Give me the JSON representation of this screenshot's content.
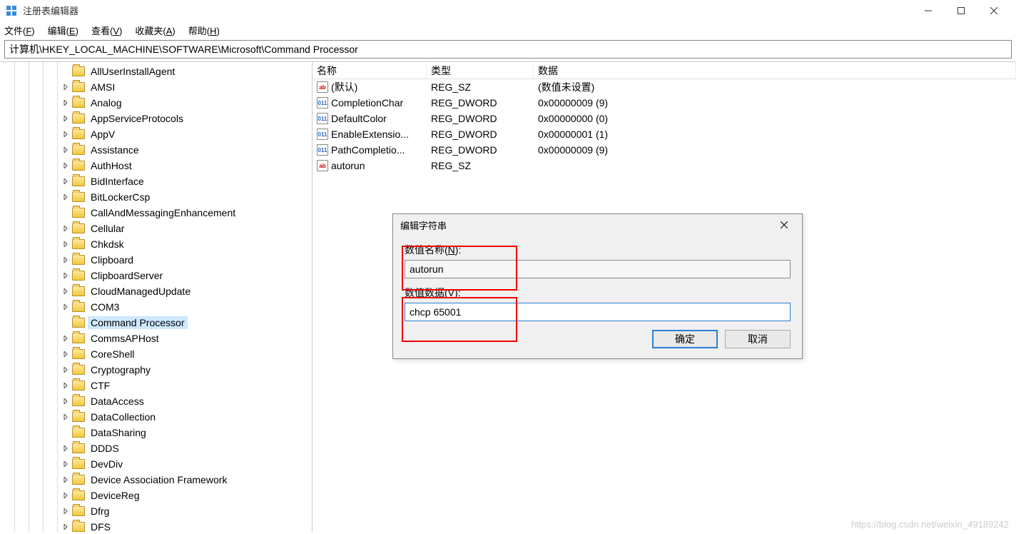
{
  "window": {
    "title": "注册表编辑器"
  },
  "menu": {
    "file": "文件(F)",
    "edit": "编辑(E)",
    "view": "查看(V)",
    "favorites": "收藏夹(A)",
    "help": "帮助(H)"
  },
  "address": "计算机\\HKEY_LOCAL_MACHINE\\SOFTWARE\\Microsoft\\Command Processor",
  "tree": {
    "items": [
      {
        "label": "AllUserInstallAgent",
        "expander": "none"
      },
      {
        "label": "AMSI",
        "expander": "closed"
      },
      {
        "label": "Analog",
        "expander": "closed"
      },
      {
        "label": "AppServiceProtocols",
        "expander": "closed"
      },
      {
        "label": "AppV",
        "expander": "closed"
      },
      {
        "label": "Assistance",
        "expander": "closed"
      },
      {
        "label": "AuthHost",
        "expander": "closed"
      },
      {
        "label": "BidInterface",
        "expander": "closed"
      },
      {
        "label": "BitLockerCsp",
        "expander": "closed"
      },
      {
        "label": "CallAndMessagingEnhancement",
        "expander": "none"
      },
      {
        "label": "Cellular",
        "expander": "closed"
      },
      {
        "label": "Chkdsk",
        "expander": "closed"
      },
      {
        "label": "Clipboard",
        "expander": "closed"
      },
      {
        "label": "ClipboardServer",
        "expander": "closed"
      },
      {
        "label": "CloudManagedUpdate",
        "expander": "closed"
      },
      {
        "label": "COM3",
        "expander": "closed"
      },
      {
        "label": "Command Processor",
        "expander": "none",
        "selected": true
      },
      {
        "label": "CommsAPHost",
        "expander": "closed"
      },
      {
        "label": "CoreShell",
        "expander": "closed"
      },
      {
        "label": "Cryptography",
        "expander": "closed"
      },
      {
        "label": "CTF",
        "expander": "closed"
      },
      {
        "label": "DataAccess",
        "expander": "closed"
      },
      {
        "label": "DataCollection",
        "expander": "closed"
      },
      {
        "label": "DataSharing",
        "expander": "none"
      },
      {
        "label": "DDDS",
        "expander": "closed"
      },
      {
        "label": "DevDiv",
        "expander": "closed"
      },
      {
        "label": "Device Association Framework",
        "expander": "closed"
      },
      {
        "label": "DeviceReg",
        "expander": "closed"
      },
      {
        "label": "Dfrg",
        "expander": "closed"
      },
      {
        "label": "DFS",
        "expander": "closed"
      }
    ]
  },
  "list": {
    "headers": {
      "name": "名称",
      "type": "类型",
      "data": "数据"
    },
    "rows": [
      {
        "icon": "sz",
        "name": "(默认)",
        "type": "REG_SZ",
        "data": "(数值未设置)"
      },
      {
        "icon": "dw",
        "name": "CompletionChar",
        "type": "REG_DWORD",
        "data": "0x00000009 (9)"
      },
      {
        "icon": "dw",
        "name": "DefaultColor",
        "type": "REG_DWORD",
        "data": "0x00000000 (0)"
      },
      {
        "icon": "dw",
        "name": "EnableExtensio...",
        "type": "REG_DWORD",
        "data": "0x00000001 (1)"
      },
      {
        "icon": "dw",
        "name": "PathCompletio...",
        "type": "REG_DWORD",
        "data": "0x00000009 (9)"
      },
      {
        "icon": "sz",
        "name": "autorun",
        "type": "REG_SZ",
        "data": ""
      }
    ]
  },
  "dialog": {
    "title": "编辑字符串",
    "name_label": "数值名称(N):",
    "name_value": "autorun",
    "data_label": "数值数据(V):",
    "data_value": "chcp 65001",
    "ok": "确定",
    "cancel": "取消"
  },
  "watermark": "https://blog.csdn.net/weixin_49189242"
}
